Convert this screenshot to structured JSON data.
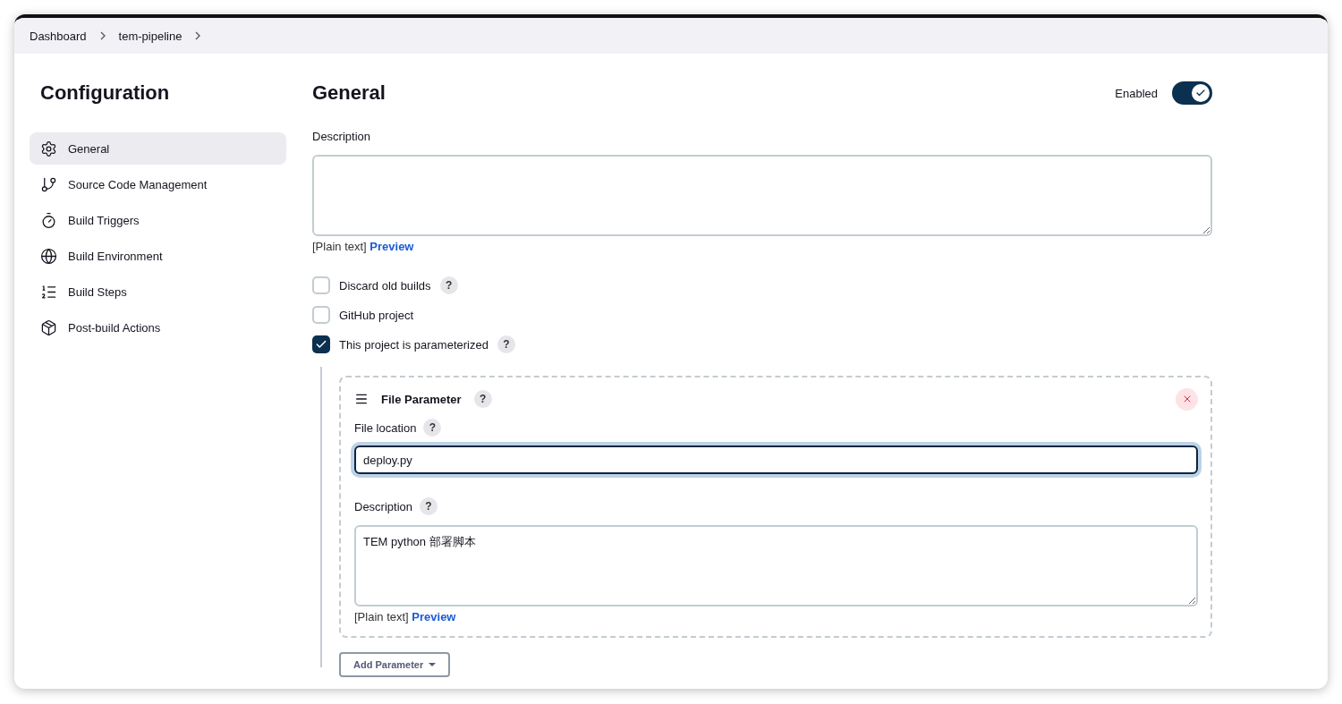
{
  "breadcrumbs": [
    {
      "label": "Dashboard"
    },
    {
      "label": "tem-pipeline"
    }
  ],
  "sidebar": {
    "title": "Configuration",
    "items": [
      {
        "label": "General",
        "selected": true
      },
      {
        "label": "Source Code Management",
        "selected": false
      },
      {
        "label": "Build Triggers",
        "selected": false
      },
      {
        "label": "Build Environment",
        "selected": false
      },
      {
        "label": "Build Steps",
        "selected": false
      },
      {
        "label": "Post-build Actions",
        "selected": false
      }
    ]
  },
  "section": {
    "title": "General",
    "toggle": {
      "label": "Enabled",
      "on": true
    }
  },
  "description": {
    "label": "Description",
    "format": "[Plain text]",
    "preview": "Preview"
  },
  "options": [
    {
      "label": "Discard old builds",
      "help": "?",
      "checked": false
    },
    {
      "label": "GitHub project",
      "checked": false
    },
    {
      "label": "This project is parameterized",
      "help": "?",
      "checked": true
    }
  ],
  "parameter": {
    "title": "File Parameter",
    "help": "?",
    "fields": [
      {
        "kind": "input",
        "label": "File location",
        "help": "?",
        "value": "deploy.py",
        "focused": true
      },
      {
        "kind": "textarea",
        "label": "Description",
        "help": "?",
        "value": "TEM python 部署脚本",
        "format": "[Plain text]",
        "preview": "Preview"
      }
    ]
  },
  "add_button": {
    "label": "Add Parameter"
  }
}
